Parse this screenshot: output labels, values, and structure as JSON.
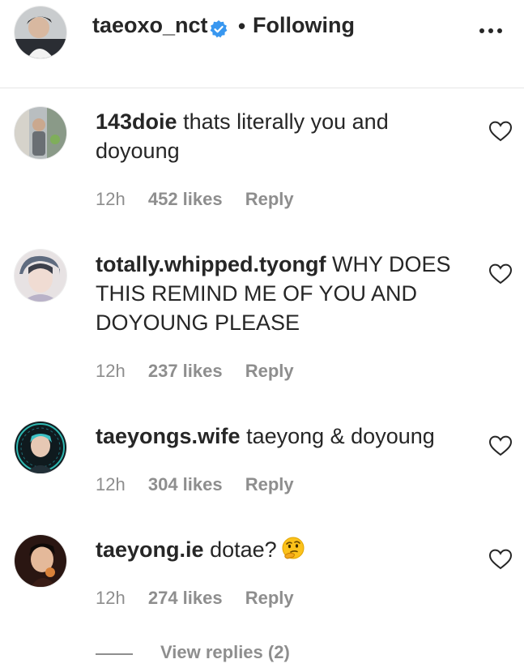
{
  "header": {
    "username": "taeoxo_nct",
    "separator": "•",
    "follow_status": "Following"
  },
  "comments": [
    {
      "username": "143doie",
      "text": "thats literally you and doyoung",
      "time": "12h",
      "likes": "452 likes",
      "reply": "Reply"
    },
    {
      "username": "totally.whipped.tyongf",
      "text": "WHY DOES THIS REMIND ME OF YOU AND DOYOUNG PLEASE",
      "time": "12h",
      "likes": "237 likes",
      "reply": "Reply"
    },
    {
      "username": "taeyongs.wife",
      "text": "taeyong & doyoung",
      "time": "12h",
      "likes": "304 likes",
      "reply": "Reply"
    },
    {
      "username": "taeyong.ie",
      "text": "dotae?",
      "emoji": "thinking-face",
      "time": "12h",
      "likes": "274 likes",
      "reply": "Reply"
    }
  ],
  "view_replies": "View replies (2)",
  "colors": {
    "text": "#262626",
    "muted": "#8e8e8e",
    "verified": "#3897f0",
    "divider": "#e6e6e6"
  },
  "icons": [
    "verified-badge-icon",
    "more-options-icon",
    "heart-icon",
    "thinking-face-emoji"
  ]
}
